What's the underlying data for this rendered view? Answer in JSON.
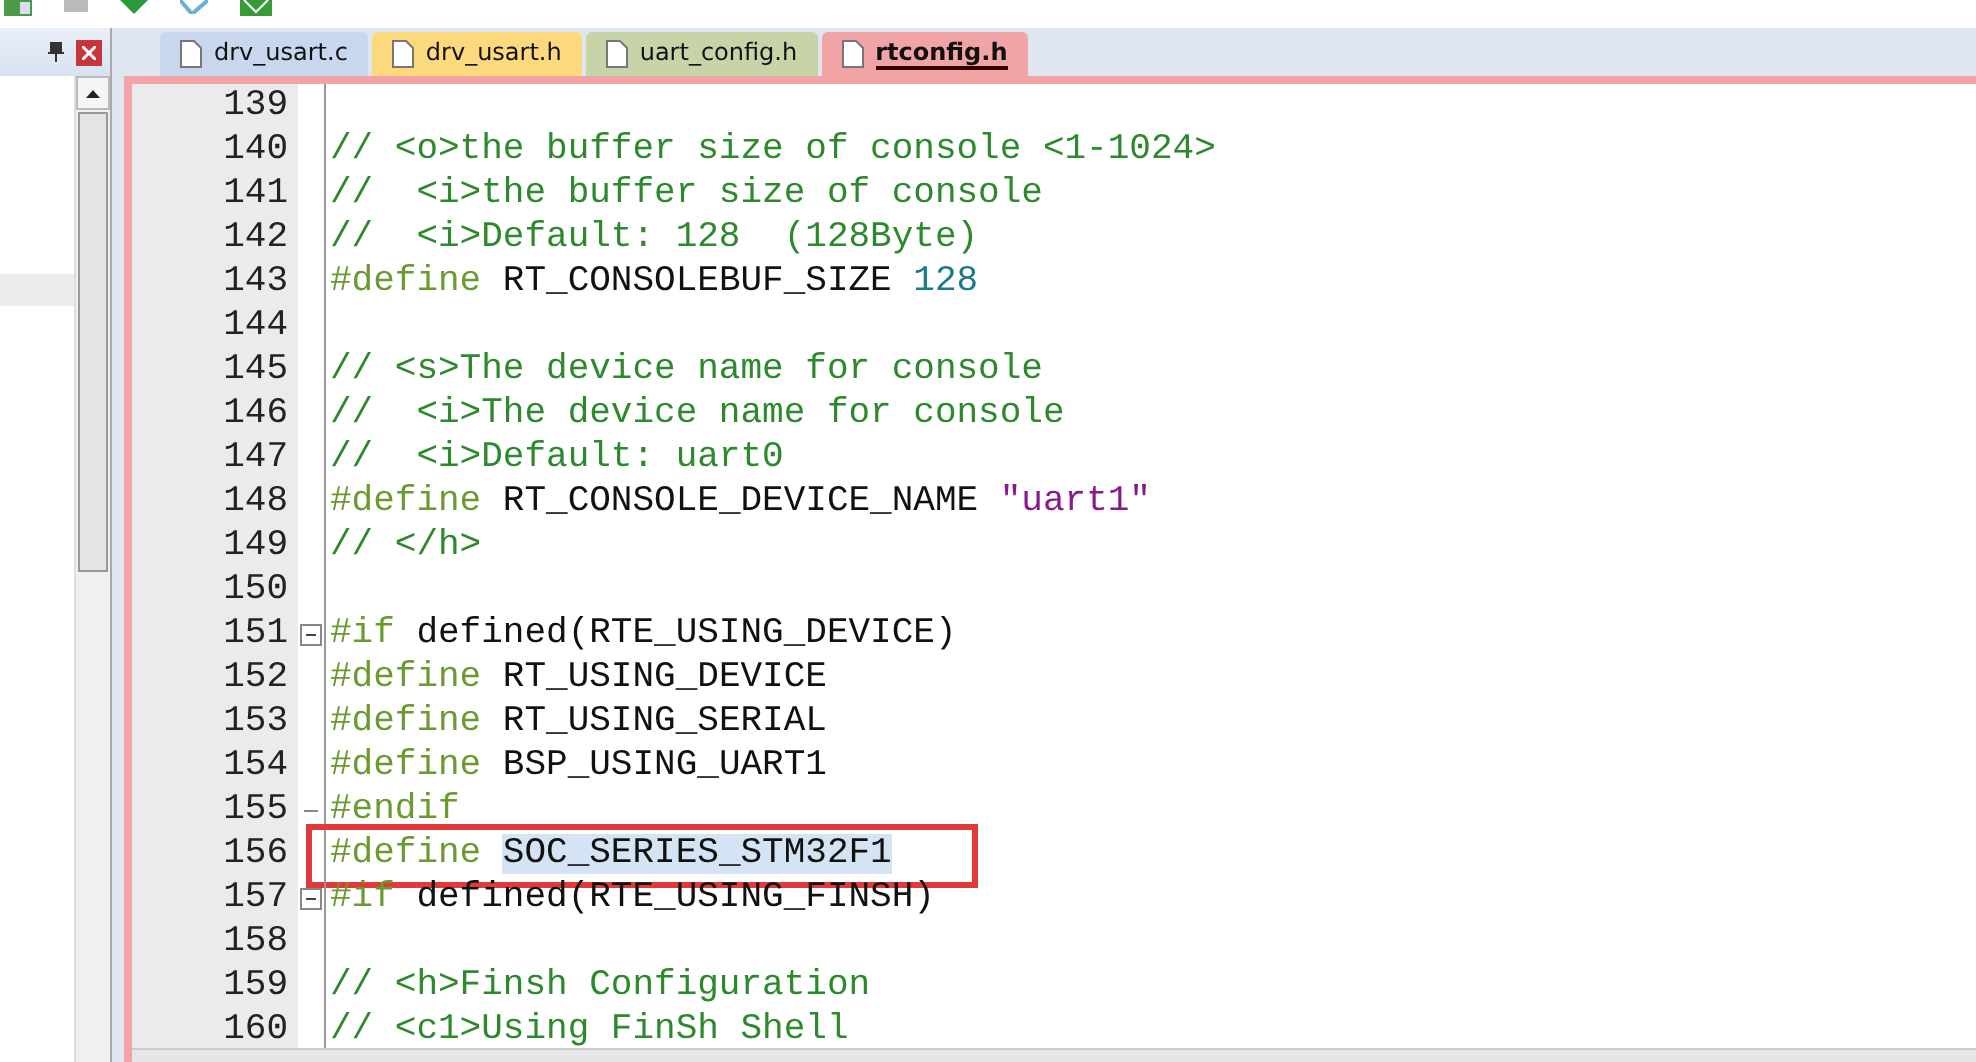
{
  "tabs": [
    {
      "label": "drv_usart.c",
      "selected": false,
      "color": "#c8d6ee"
    },
    {
      "label": "drv_usart.h",
      "selected": false,
      "color": "#fbd97c"
    },
    {
      "label": "uart_config.h",
      "selected": false,
      "color": "#c6d4a8"
    },
    {
      "label": "rtconfig.h",
      "selected": true,
      "color": "#f2a3a5"
    }
  ],
  "editor": {
    "lines": [
      {
        "number": "139"
      },
      {
        "number": "140",
        "segments": [
          {
            "kind": "comment",
            "text": "// <o>the buffer size of console <1-1024>"
          }
        ]
      },
      {
        "number": "141",
        "segments": [
          {
            "kind": "comment",
            "text": "//  <i>the buffer size of console"
          }
        ]
      },
      {
        "number": "142",
        "segments": [
          {
            "kind": "comment",
            "text": "//  <i>Default: 128  (128Byte)"
          }
        ]
      },
      {
        "number": "143",
        "segments": [
          {
            "kind": "directive",
            "text": "#define"
          },
          {
            "kind": "plain",
            "text": " RT_CONSOLEBUF_SIZE "
          },
          {
            "kind": "number",
            "text": "128"
          }
        ]
      },
      {
        "number": "144"
      },
      {
        "number": "145",
        "segments": [
          {
            "kind": "comment",
            "text": "// <s>The device name for console"
          }
        ]
      },
      {
        "number": "146",
        "segments": [
          {
            "kind": "comment",
            "text": "//  <i>The device name for console"
          }
        ]
      },
      {
        "number": "147",
        "segments": [
          {
            "kind": "comment",
            "text": "//  <i>Default: uart0"
          }
        ]
      },
      {
        "number": "148",
        "segments": [
          {
            "kind": "directive",
            "text": "#define"
          },
          {
            "kind": "plain",
            "text": " RT_CONSOLE_DEVICE_NAME "
          },
          {
            "kind": "string",
            "text": "\"uart1\""
          }
        ]
      },
      {
        "number": "149",
        "segments": [
          {
            "kind": "comment",
            "text": "// </h>"
          }
        ]
      },
      {
        "number": "150"
      },
      {
        "number": "151",
        "fold_start": true,
        "segments": [
          {
            "kind": "directive",
            "text": "#if"
          },
          {
            "kind": "plain",
            "text": " defined(RTE_USING_DEVICE)"
          }
        ]
      },
      {
        "number": "152",
        "segments": [
          {
            "kind": "directive",
            "text": "#define"
          },
          {
            "kind": "plain",
            "text": " RT_USING_DEVICE"
          }
        ]
      },
      {
        "number": "153",
        "segments": [
          {
            "kind": "directive",
            "text": "#define"
          },
          {
            "kind": "plain",
            "text": " RT_USING_SERIAL"
          }
        ]
      },
      {
        "number": "154",
        "segments": [
          {
            "kind": "directive",
            "text": "#define"
          },
          {
            "kind": "plain",
            "text": " BSP_USING_UART1"
          }
        ]
      },
      {
        "number": "155",
        "fold_end": true,
        "segments": [
          {
            "kind": "directive",
            "text": "#endif"
          }
        ]
      },
      {
        "number": "156",
        "boxed": true,
        "segments": [
          {
            "kind": "directive",
            "text": "#define "
          },
          {
            "kind": "selected",
            "text": "SOC_SERIES_STM32F1"
          }
        ]
      },
      {
        "number": "157",
        "fold_start": true,
        "segments": [
          {
            "kind": "directive",
            "text": "#if"
          },
          {
            "kind": "plain",
            "text": " defined(RTE_USING_FINSH)"
          }
        ]
      },
      {
        "number": "158"
      },
      {
        "number": "159",
        "segments": [
          {
            "kind": "comment",
            "text": "// <h>Finsh Configuration"
          }
        ]
      },
      {
        "number": "160",
        "segments": [
          {
            "kind": "comment",
            "text": "// <c1>Using FinSh Shell"
          }
        ]
      }
    ]
  }
}
